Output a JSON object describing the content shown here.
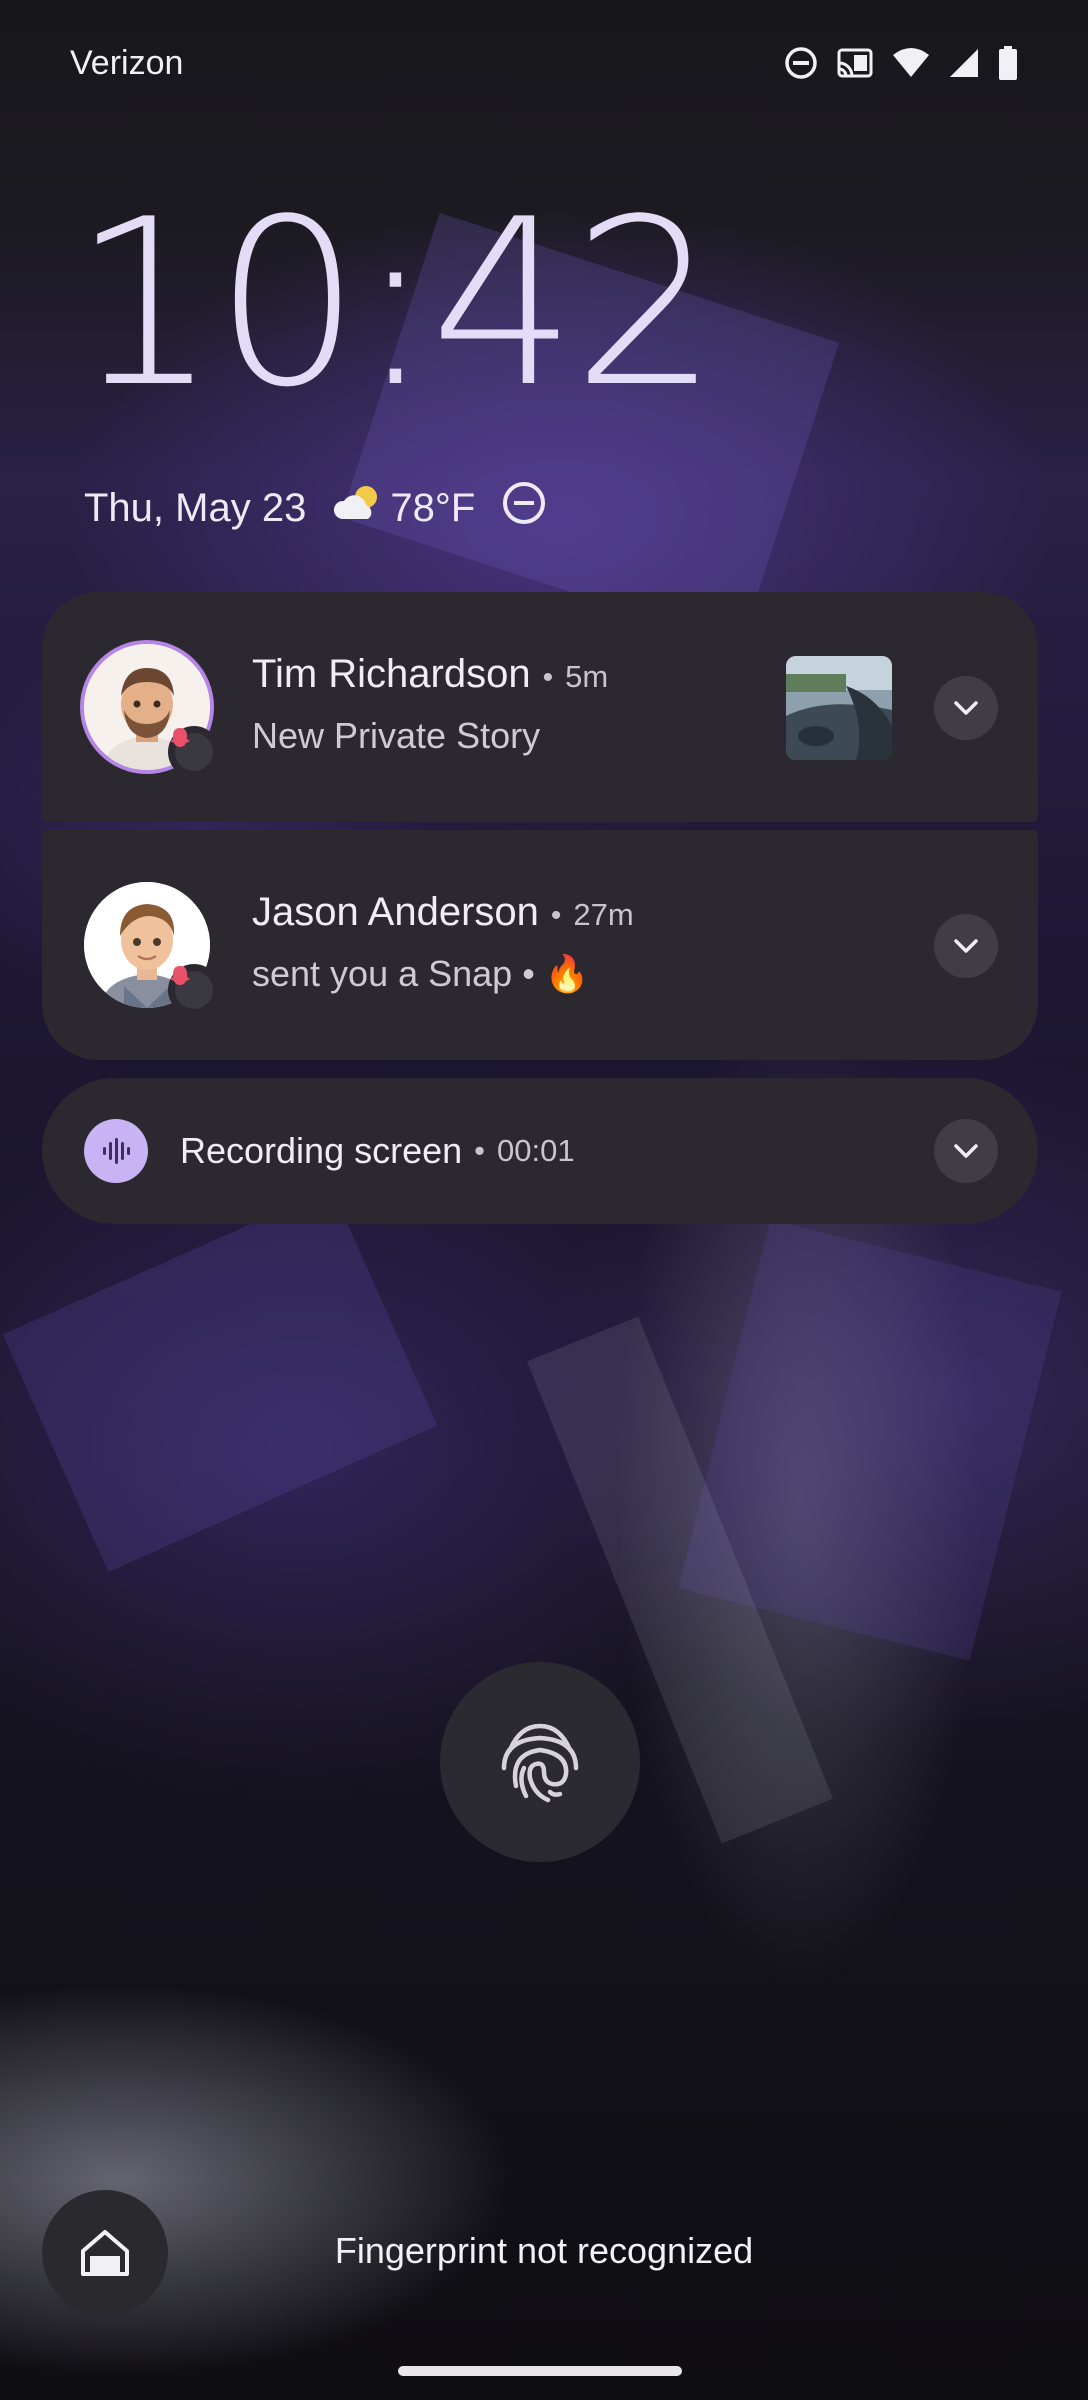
{
  "status_bar": {
    "carrier": "Verizon",
    "icons": [
      "do-not-disturb-icon",
      "cast-icon",
      "wifi-icon",
      "cell-signal-icon",
      "battery-icon"
    ]
  },
  "lock_screen": {
    "time": "10:42",
    "date": "Thu, May 23",
    "weather_icon": "partly-cloudy-icon",
    "temperature": "78°F",
    "dnd_icon": "do-not-disturb-icon"
  },
  "notifications": [
    {
      "sender": "Tim Richardson",
      "separator": "•",
      "time": "5m",
      "message": "New Private Story",
      "app_icon": "snapchat-icon",
      "has_thumbnail": true
    },
    {
      "sender": "Jason Anderson",
      "separator": "•",
      "time": "27m",
      "message": "sent you a Snap • 🔥",
      "app_icon": "snapchat-icon"
    }
  ],
  "recording": {
    "title": "Recording screen",
    "separator": "•",
    "elapsed": "00:01",
    "icon": "sound-wave-icon"
  },
  "bottom": {
    "fingerprint_icon": "fingerprint-icon",
    "home_icon": "home-icon",
    "message": "Fingerprint not recognized"
  },
  "colors": {
    "clock": "#e3dcf6",
    "card": "#2b292f",
    "accent": "#c8b4f5",
    "avatar_ring": "#b586e6",
    "snap_badge": "#e9516b"
  }
}
